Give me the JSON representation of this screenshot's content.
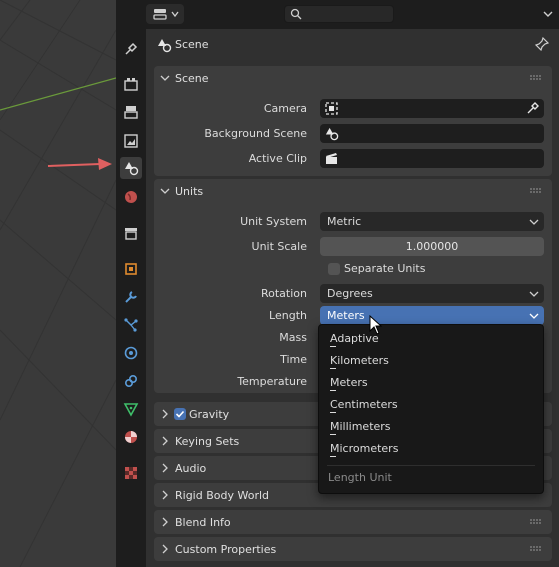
{
  "colors": {
    "accent": "#4772b3",
    "annotation_arrow": "#e06060",
    "grid_line_green": "#6a9a3a",
    "panel_bg": "#3d3d3d"
  },
  "header": {
    "editor_type_icon": "properties-editor-icon",
    "search_icon": "search-icon"
  },
  "tabs": [
    {
      "icon": "tool-icon",
      "active": false
    },
    {
      "icon": "render-icon",
      "active": false
    },
    {
      "icon": "output-icon",
      "active": false
    },
    {
      "icon": "view-layer-icon",
      "active": false
    },
    {
      "icon": "scene-icon",
      "active": true
    },
    {
      "icon": "world-icon",
      "active": false
    },
    {
      "icon": "collection-icon",
      "active": false
    },
    {
      "icon": "object-icon",
      "active": false
    },
    {
      "icon": "modifier-icon",
      "active": false
    },
    {
      "icon": "particles-icon",
      "active": false
    },
    {
      "icon": "physics-icon",
      "active": false
    },
    {
      "icon": "constraints-icon",
      "active": false
    },
    {
      "icon": "data-icon",
      "active": false
    },
    {
      "icon": "material-icon",
      "active": false
    },
    {
      "icon": "texture-icon",
      "active": false
    }
  ],
  "context": {
    "title": "Scene"
  },
  "scene_panel": {
    "title": "Scene",
    "camera_label": "Camera",
    "background_scene_label": "Background Scene",
    "active_clip_label": "Active Clip"
  },
  "units_panel": {
    "title": "Units",
    "unit_system_label": "Unit System",
    "unit_system_value": "Metric",
    "unit_scale_label": "Unit Scale",
    "unit_scale_value": "1.000000",
    "separate_units_label": "Separate Units",
    "separate_units_checked": false,
    "rotation_label": "Rotation",
    "rotation_value": "Degrees",
    "length_label": "Length",
    "length_value": "Meters",
    "mass_label": "Mass",
    "time_label": "Time",
    "temperature_label": "Temperature"
  },
  "collapsed_panels": {
    "gravity": "Gravity",
    "keying_sets": "Keying Sets",
    "audio": "Audio",
    "rigid_body_world": "Rigid Body World",
    "blend_info": "Blend Info",
    "custom_properties": "Custom Properties"
  },
  "gravity_checked": true,
  "length_menu": {
    "items": [
      "Adaptive",
      "Kilometers",
      "Meters",
      "Centimeters",
      "Millimeters",
      "Micrometers"
    ],
    "title": "Length Unit"
  }
}
